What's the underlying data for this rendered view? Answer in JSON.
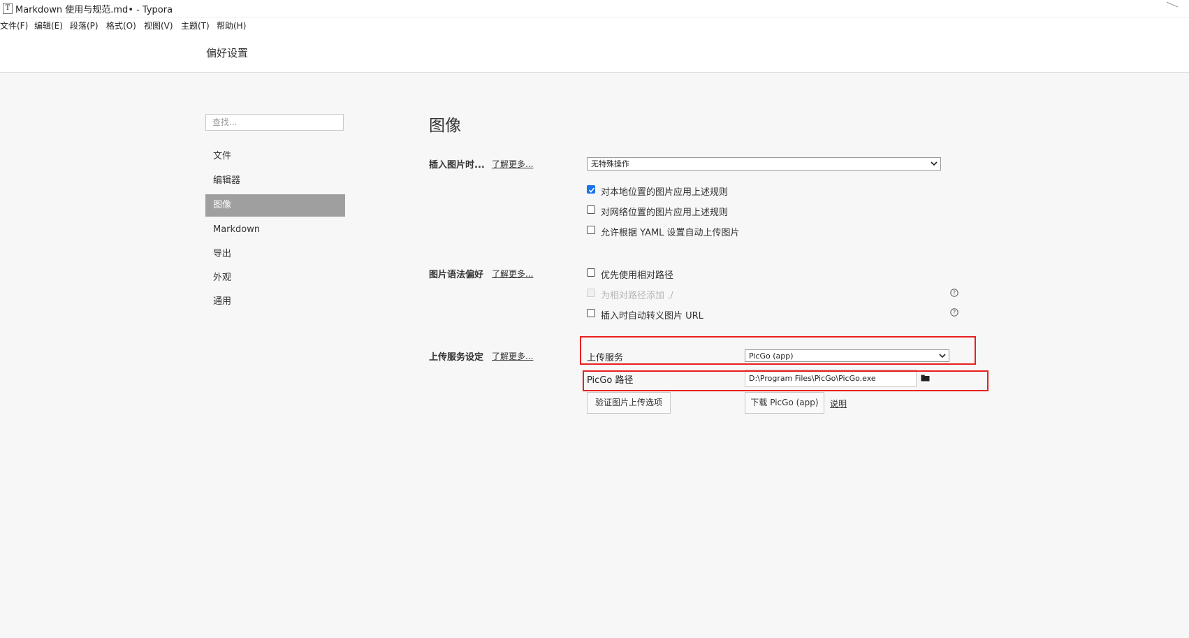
{
  "window": {
    "title": "Markdown 使用与规范.md• - Typora",
    "app_icon": "T"
  },
  "menu": {
    "items": [
      {
        "label": "文件(F)"
      },
      {
        "label": "编辑(E)"
      },
      {
        "label": "段落(P)"
      },
      {
        "label": "格式(O)"
      },
      {
        "label": "视图(V)"
      },
      {
        "label": "主题(T)"
      },
      {
        "label": "帮助(H)"
      }
    ]
  },
  "header": {
    "title": "偏好设置"
  },
  "sidebar": {
    "search_placeholder": "查找...",
    "items": [
      {
        "label": "文件",
        "active": false
      },
      {
        "label": "编辑器",
        "active": false
      },
      {
        "label": "图像",
        "active": true
      },
      {
        "label": "Markdown",
        "active": false
      },
      {
        "label": "导出",
        "active": false
      },
      {
        "label": "外观",
        "active": false
      },
      {
        "label": "通用",
        "active": false
      }
    ]
  },
  "main": {
    "heading": "图像",
    "insert_image": {
      "label": "插入图片时...",
      "learn_more": "了解更多...",
      "select_value": "无特殊操作",
      "options": [
        {
          "label": "对本地位置的图片应用上述规则",
          "checked": true,
          "disabled": false
        },
        {
          "label": "对网络位置的图片应用上述规则",
          "checked": false,
          "disabled": false
        },
        {
          "label": "允许根据 YAML 设置自动上传图片",
          "checked": false,
          "disabled": false
        }
      ]
    },
    "syntax_pref": {
      "label": "图片语法偏好",
      "learn_more": "了解更多...",
      "options": [
        {
          "label": "优先使用相对路径",
          "checked": false,
          "disabled": false
        },
        {
          "label": "为相对路径添加 ./",
          "checked": false,
          "disabled": true
        },
        {
          "label": "插入时自动转义图片 URL",
          "checked": false,
          "disabled": false
        }
      ]
    },
    "upload": {
      "label": "上传服务设定",
      "learn_more": "了解更多...",
      "service_label": "上传服务",
      "service_value": "PicGo (app)",
      "path_label": "PicGo 路径",
      "path_value": "D:\\Program Files\\PicGo\\PicGo.exe",
      "verify_button": "验证图片上传选项",
      "download_button": "下载 PicGo (app)",
      "help_link": "说明"
    }
  },
  "colors": {
    "accent": "#1a73e8",
    "highlight": "#e8201f",
    "active_nav": "#9f9f9f"
  },
  "icons": {
    "help": "question-circle-icon",
    "folder": "folder-icon",
    "dropdown": "chevron-down-icon"
  }
}
